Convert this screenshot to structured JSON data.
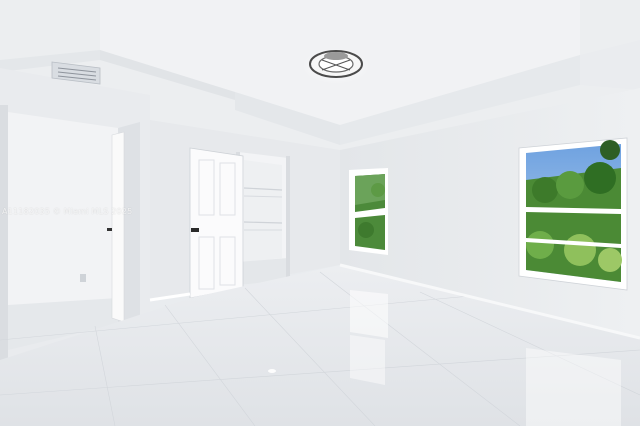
{
  "watermark": {
    "text": "A11182035 © Miami MLS 2025"
  },
  "scene": {
    "elements": [
      "tray-ceiling",
      "ceiling-light-fixture",
      "air-vent",
      "open-doorway-left",
      "open-door",
      "walk-in-closet",
      "window-small",
      "window-large",
      "tile-floor"
    ]
  },
  "colors": {
    "wall": "#e6e9ec",
    "ceiling": "#eef0f2",
    "floor": "#e2e5e9",
    "foliage": "#3f7d2f",
    "sky": "#8fb8e8"
  }
}
